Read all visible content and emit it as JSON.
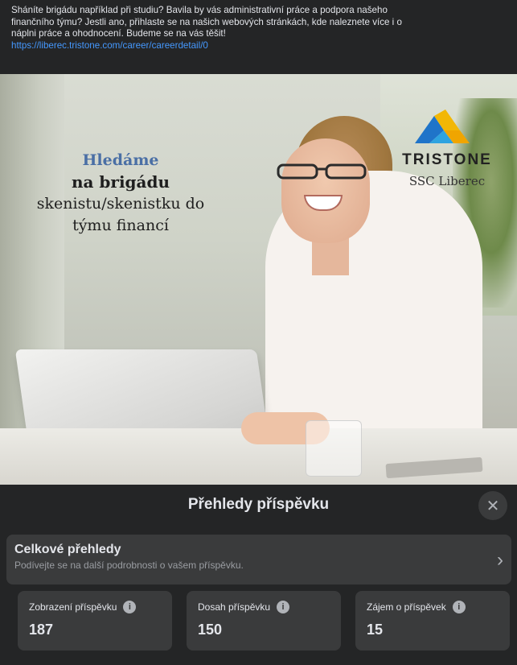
{
  "post": {
    "text": "Sháníte brigádu například při studiu? Bavila by vás administrativní práce a podpora našeho\nfinančního týmu? Jestli ano, přihlaste se na našich webových stránkách, kde naleznete více i o\nnáplni práce a ohodnocení. Budeme se na vás těšit!",
    "link": "https://liberec.tristone.com/career/careerdetail/0"
  },
  "ad": {
    "line1": "Hledáme",
    "line2": "na brigádu",
    "line3": "skenistu/skenistku do",
    "line4": "týmu financí"
  },
  "logo": {
    "brand": "TRISTONE",
    "sub": "SSC Liberec"
  },
  "insights": {
    "title": "Přehledy příspěvku",
    "close_icon": "close-icon",
    "overall_title": "Celkové přehledy",
    "overall_subtitle": "Podívejte se na další podrobnosti o vašem příspěvku.",
    "cards": [
      {
        "label": "Zobrazení příspěvku",
        "value": "187"
      },
      {
        "label": "Dosah příspěvku",
        "value": "150"
      },
      {
        "label": "Zájem o příspěvek",
        "value": "15"
      }
    ]
  },
  "colors": {
    "background": "#242526",
    "card": "#3a3b3c",
    "link": "#4599ff",
    "ad_accent": "#4a6fa5"
  }
}
